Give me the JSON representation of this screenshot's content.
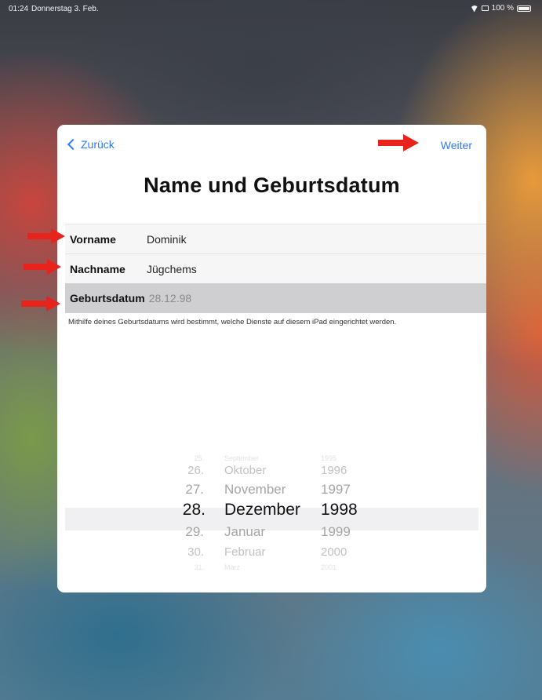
{
  "statusbar": {
    "time": "01:24",
    "date": "Donnerstag 3. Feb.",
    "battery": "100 %"
  },
  "nav": {
    "back_label": "Zurück",
    "next_label": "Weiter"
  },
  "title": "Name und Geburtsdatum",
  "form": {
    "first_name_label": "Vorname",
    "first_name_value": "Dominik",
    "last_name_label": "Nachname",
    "last_name_value": "Jügchems",
    "birthdate_label": "Geburtsdatum",
    "birthdate_value": "28.12.98"
  },
  "hint": "Mithilfe deines Geburtsdatums wird bestimmt, welche Dienste auf diesem iPad eingerichtet werden.",
  "picker": {
    "rows": [
      {
        "day": "25.",
        "month": "September",
        "year": "1995"
      },
      {
        "day": "26.",
        "month": "Oktober",
        "year": "1996"
      },
      {
        "day": "27.",
        "month": "November",
        "year": "1997"
      },
      {
        "day": "28.",
        "month": "Dezember",
        "year": "1998"
      },
      {
        "day": "29.",
        "month": "Januar",
        "year": "1999"
      },
      {
        "day": "30.",
        "month": "Februar",
        "year": "2000"
      },
      {
        "day": "31.",
        "month": "März",
        "year": "2001"
      }
    ],
    "selected_index": 3
  },
  "colors": {
    "accent": "#2f7bf6",
    "annotation_arrow": "#e8231c"
  }
}
